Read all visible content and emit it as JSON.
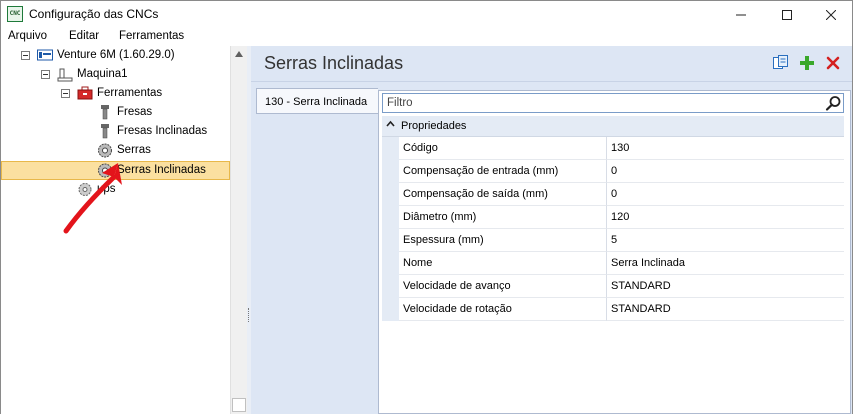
{
  "window": {
    "icon_text": "CNC",
    "title": "Configuração das CNCs",
    "icons": [
      "app-icon",
      "minimize-icon",
      "maximize-icon",
      "close-icon"
    ]
  },
  "menu": {
    "items": [
      "Arquivo",
      "Editar",
      "Ferramentas"
    ]
  },
  "tree": {
    "nodes": [
      {
        "label": "Venture 6M (1.60.29.0)",
        "icon": "machine-icon"
      },
      {
        "label": "Maquina1",
        "icon": "machine-base-icon"
      },
      {
        "label": "Ferramentas",
        "icon": "toolbox-icon"
      },
      {
        "label": "Fresas",
        "icon": "drill-bit-icon"
      },
      {
        "label": "Fresas Inclinadas",
        "icon": "drill-bit-icon"
      },
      {
        "label": "Serras",
        "icon": "saw-blade-icon"
      },
      {
        "label": "Serras Inclinadas",
        "icon": "saw-blade-icon"
      },
      {
        "label": "ups",
        "icon": "gear-icon"
      }
    ],
    "selected": "Serras Inclinadas"
  },
  "right": {
    "title": "Serras Inclinadas",
    "toolbar_icons": [
      "copy-icon",
      "add-icon",
      "delete-icon"
    ],
    "tabs": [
      "130 - Serra Inclinada"
    ],
    "filter_placeholder": "Filtro",
    "category": "Propriedades",
    "properties": [
      {
        "name": "Código",
        "value": "130"
      },
      {
        "name": "Compensação de entrada (mm)",
        "value": "0"
      },
      {
        "name": "Compensação de saída (mm)",
        "value": "0"
      },
      {
        "name": "Diâmetro (mm)",
        "value": "120"
      },
      {
        "name": "Espessura (mm)",
        "value": "5"
      },
      {
        "name": "Nome",
        "value": "Serra Inclinada"
      },
      {
        "name": "Velocidade de avanço",
        "value": "STANDARD"
      },
      {
        "name": "Velocidade de rotação",
        "value": "STANDARD"
      }
    ]
  },
  "colors": {
    "selection_bg": "#fbe0a0",
    "selection_border": "#e8b84a",
    "panel_bg": "#dde6f4",
    "add_green": "#3aa82a",
    "delete_red": "#d42020",
    "annotation_red": "#e3141b"
  }
}
